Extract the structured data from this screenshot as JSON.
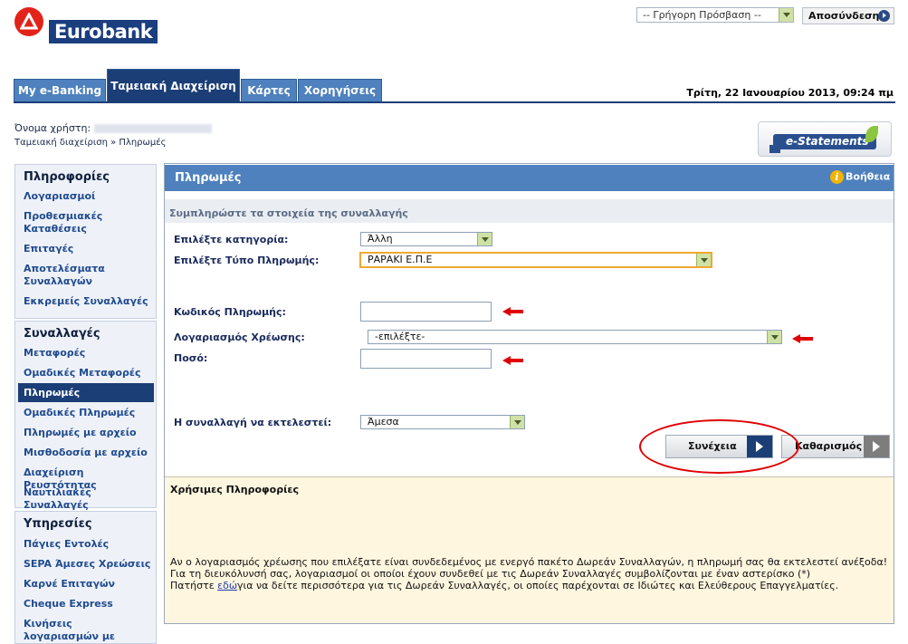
{
  "brand": {
    "name": "Eurobank",
    "logo_color": "#e2231a",
    "brand_color": "#1a3e7e"
  },
  "top": {
    "quick_access": "-- Γρήγορη Πρόσβαση --",
    "logout": "Αποσύνδεση"
  },
  "tabs": [
    {
      "label": "My e-Banking"
    },
    {
      "label": "Ταμειακή Διαχείριση",
      "active": true
    },
    {
      "label": "Κάρτες"
    },
    {
      "label": "Χορηγήσεις"
    }
  ],
  "date_time": "Τρίτη, 22 Ιανουαρίου 2013, 09:24 πμ",
  "user": {
    "label": "Όνομα χρήστη:"
  },
  "breadcrumb": "Ταμειακή διαχείριση » Πληρωμές",
  "estatements": {
    "label": "e-Statements"
  },
  "sidebar": {
    "info": {
      "heading": "Πληροφορίες",
      "items": [
        "Λογαριασμοί",
        "Προθεσμιακές Καταθέσεις",
        "Επιταγές",
        "Αποτελέσματα Συναλλαγών",
        "Εκκρεμείς Συναλλαγές"
      ]
    },
    "transactions": {
      "heading": "Συναλλαγές",
      "items": [
        "Μεταφορές",
        "Ομαδικές Μεταφορές",
        "Πληρωμές",
        "Ομαδικές Πληρωμές",
        "Πληρωμές με αρχείο",
        "Μισθοδοσία με αρχείο",
        "Διαχείριση Ρευστότητας",
        "Ναυτιλιακές Συναλλαγές"
      ],
      "active": "Πληρωμές"
    },
    "services": {
      "heading": "Υπηρεσίες",
      "items": [
        "Πάγιες Εντολές",
        "SEPA Άμεσες Χρεώσεις",
        "Καρνέ Επιταγών",
        "Cheque Express",
        "Κινήσεις λογαριασμών με αρχείο"
      ]
    }
  },
  "main": {
    "title": "Πληρωμές",
    "help": "Βοήθεια",
    "subtitle": "Συμπληρώστε τα στοιχεία της συναλλαγής",
    "fields": {
      "category_label": "Επιλέξτε κατηγορία:",
      "category_value": "Άλλη",
      "payment_type_label": "Επιλέξτε Τύπο Πληρωμής:",
      "payment_type_value": "ΡΑΡΑΚΙ Ε.Π.Ε",
      "payment_code_label": "Κωδικός Πληρωμής:",
      "payment_code_value": "",
      "debit_account_label": "Λογαριασμός Χρέωσης:",
      "debit_account_value": "-επιλέξτε-",
      "amount_label": "Ποσό:",
      "amount_value": "",
      "execute_label": "Η συναλλαγή να εκτελεστεί:",
      "execute_value": "Άμεσα"
    },
    "buttons": {
      "continue": "Συνέχεια",
      "clear": "Καθαρισμός"
    }
  },
  "info": {
    "title": "Χρήσιμες Πληροφορίες",
    "line1": "Αν ο λογαριασμός χρέωσης που επιλέξατε είναι συνδεδεμένος με ενεργό πακέτο Δωρεάν Συναλλαγών, η πληρωμή σας θα εκτελεστεί ανέξοδα!",
    "line2": "Για τη διευκόλυνσή σας, λογαριασμοί οι οποίοι έχουν συνδεθεί με τις Δωρεάν Συναλλαγές συμβολίζονται με έναν αστερίσκο (*)",
    "line3_pre": "Πατήστε ",
    "line3_link": "εδώ",
    "line3_post": "για να δείτε περισσότερα για τις Δωρεάν Συναλλαγές, οι οποίες παρέχονται σε Ιδιώτες και Ελεύθερους Επαγγελματίες."
  }
}
